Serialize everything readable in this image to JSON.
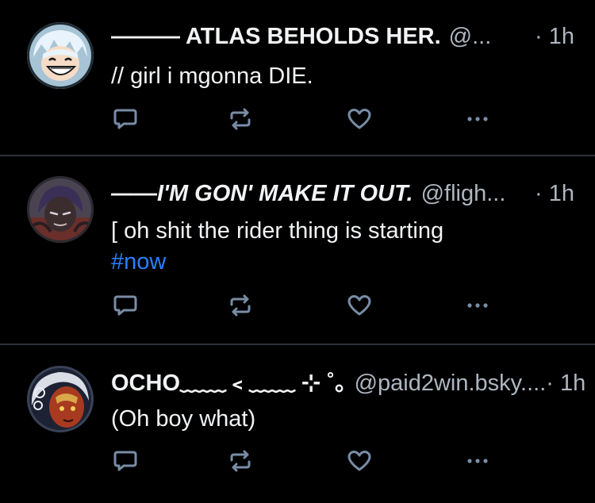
{
  "feed": {
    "posts": [
      {
        "name": "——— ATLAS BEHOLDS HER.",
        "handle": "@...",
        "time": "· 1h",
        "text": "// girl i mgonna DIE.",
        "tag": ""
      },
      {
        "name": "——I'M GON' MAKE IT OUT.",
        "handle": "@fligh...",
        "time": "· 1h",
        "text": "[ oh shit the rider thing is starting",
        "tag": "#now"
      },
      {
        "name": "OCHO﹏﹏﹤﹏﹏ ⊹ ˚｡",
        "handle": "@paid2win.bsky....",
        "time": "· 1h",
        "text": "(Oh boy what)",
        "tag": ""
      }
    ]
  },
  "icons": {
    "reply": "speech-bubble-icon",
    "repost": "repost-arrows-icon",
    "like": "heart-icon",
    "more": "ellipsis-icon"
  },
  "colors": {
    "background": "#000000",
    "divider": "#2e3238",
    "text": "#f1f3f5",
    "muted": "#aeb6c0",
    "icon": "#788ca6",
    "hashtag": "#2b7fff"
  }
}
